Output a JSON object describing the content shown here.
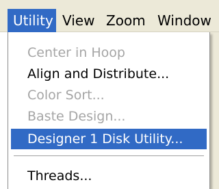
{
  "menubar": {
    "items": [
      {
        "label": "Utility",
        "active": true
      },
      {
        "label": "View",
        "active": false
      },
      {
        "label": "Zoom",
        "active": false
      },
      {
        "label": "Window",
        "active": false
      }
    ]
  },
  "dropdown": {
    "items": [
      {
        "label": "Center in Hoop",
        "state": "disabled"
      },
      {
        "label": "Align and Distribute...",
        "state": "enabled"
      },
      {
        "label": "Color Sort...",
        "state": "disabled"
      },
      {
        "label": "Baste Design...",
        "state": "disabled"
      },
      {
        "label": "Designer 1 Disk Utility...",
        "state": "highlighted"
      },
      {
        "label": "Threads...",
        "state": "enabled"
      }
    ]
  },
  "colors": {
    "highlight": "#316ac5",
    "menubar_bg": "#ece9d8",
    "disabled_text": "#a5a5a5"
  }
}
